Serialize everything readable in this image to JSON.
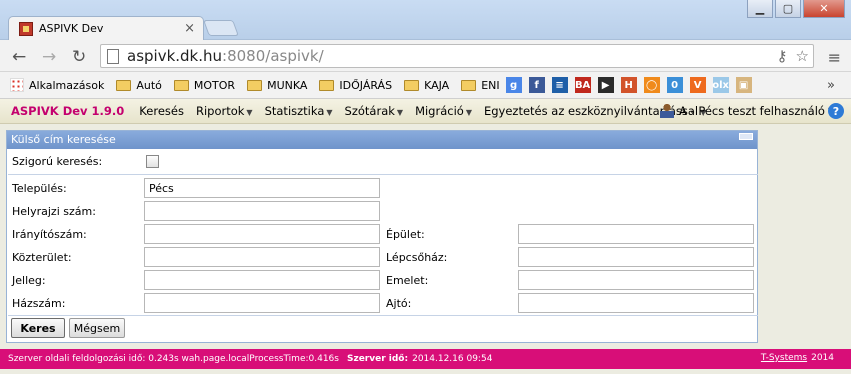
{
  "browser": {
    "tab_title": "ASPIVK Dev",
    "url_host": "aspivk.dk.hu",
    "url_rest": ":8080/aspivk/",
    "bookmarks": {
      "apps_label": "Alkalmazások",
      "folders": [
        "Autó",
        "MOTOR",
        "MUNKA",
        "IDŐJÁRÁS",
        "KAJA",
        "ENI"
      ],
      "site_icons": [
        {
          "name": "google-icon",
          "glyph": "g",
          "color": "#4a86e8"
        },
        {
          "name": "facebook-icon",
          "glyph": "f",
          "color": "#3b5998"
        },
        {
          "name": "site-icon-blue",
          "glyph": "≡",
          "color": "#1f5fa8"
        },
        {
          "name": "ba-icon",
          "glyph": "BA",
          "color": "#c0281d"
        },
        {
          "name": "play-icon",
          "glyph": "▶",
          "color": "#2b2b2b"
        },
        {
          "name": "h-icon",
          "glyph": "H",
          "color": "#d2532b"
        },
        {
          "name": "ring-icon",
          "glyph": "◯",
          "color": "#f08a1b"
        },
        {
          "name": "zero-icon",
          "glyph": "0",
          "color": "#3b8fd8"
        },
        {
          "name": "v-icon",
          "glyph": "V",
          "color": "#ee6a1e"
        },
        {
          "name": "olx-icon",
          "glyph": "olx",
          "color": "#9bc8e8"
        },
        {
          "name": "box-icon",
          "glyph": "▣",
          "color": "#d7b57e"
        }
      ]
    }
  },
  "app": {
    "brand": "ASPIVK Dev 1.9.0",
    "menu": [
      "Keresés",
      "Riportok",
      "Statisztika",
      "Szótárak",
      "Migráció",
      "Egyeztetés az eszköznyilvántartással"
    ],
    "menu_has_arrow": [
      false,
      true,
      true,
      true,
      true,
      true
    ],
    "user": "A - Pécs teszt felhasználó",
    "help": "?"
  },
  "panel": {
    "title": "Külső cím keresése",
    "strict_label": "Szigorú keresés:",
    "fields": {
      "telepules": {
        "label": "Település:",
        "value": "Pécs"
      },
      "helyrajzi": {
        "label": "Helyrajzi szám:",
        "value": ""
      },
      "iranyitoszam": {
        "label": "Irányítószám:",
        "value": ""
      },
      "kozterulet": {
        "label": "Közterület:",
        "value": ""
      },
      "jelleg": {
        "label": "Jelleg:",
        "value": ""
      },
      "hazszam": {
        "label": "Házszám:",
        "value": ""
      },
      "epulet": {
        "label": "Épület:",
        "value": ""
      },
      "lepcsohaz": {
        "label": "Lépcsőház:",
        "value": ""
      },
      "emelet": {
        "label": "Emelet:",
        "value": ""
      },
      "ajto": {
        "label": "Ajtó:",
        "value": ""
      }
    },
    "search_button": "Keres",
    "cancel_button": "Mégsem"
  },
  "status": {
    "processing": "Szerver oldali feldolgozási idő: 0.243s wah.page.localProcessTime:0.416s",
    "server_time_label": "Szerver idő:",
    "server_time": "2014.12.16 09:54",
    "company": "T-Systems",
    "year": "2014"
  }
}
